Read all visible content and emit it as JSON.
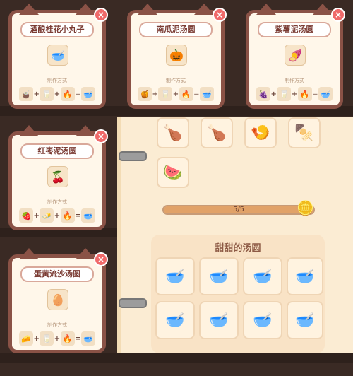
{
  "cards": [
    {
      "id": "c1",
      "title": "酒酿桂花小丸子",
      "method": "制作方式",
      "item": "🥣",
      "ings": [
        "🧉",
        "🥛",
        "🔥",
        "🥣"
      ]
    },
    {
      "id": "c2",
      "title": "南瓜泥汤圆",
      "method": "制作方式",
      "item": "🎃",
      "ings": [
        "🍯",
        "🥛",
        "🔥",
        "🥣"
      ]
    },
    {
      "id": "c3",
      "title": "紫薯泥汤圆",
      "method": "制作方式",
      "item": "🍠",
      "ings": [
        "🍇",
        "🥛",
        "🔥",
        "🥣"
      ]
    },
    {
      "id": "c4",
      "title": "红枣泥汤圆",
      "method": "制作方式",
      "item": "🍒",
      "ings": [
        "🍓",
        "🧈",
        "🔥",
        "🥣"
      ]
    },
    {
      "id": "c5",
      "title": "蛋黄流沙汤圆",
      "method": "制作方式",
      "item": "🥚",
      "ings": [
        "🧀",
        "🥛",
        "🔥",
        "🥣"
      ]
    }
  ],
  "book": {
    "progress": {
      "text": "5/5",
      "value": 1.0
    },
    "section_title": "甜甜的汤圆",
    "top_items": [
      "🍗",
      "🍗",
      "🍤",
      "🍢"
    ],
    "extra_item": "🍉",
    "soups": [
      "🥣",
      "🥣",
      "🥣",
      "🥣",
      "🥣",
      "🥣",
      "🥣",
      "🥣"
    ]
  },
  "colors": {
    "card_border": "#8a5246",
    "close": "#f06a6a",
    "book": "#fbecd3",
    "progress_fill": "#e1a268"
  },
  "icons": {
    "close": "×",
    "gold": "🪙"
  }
}
